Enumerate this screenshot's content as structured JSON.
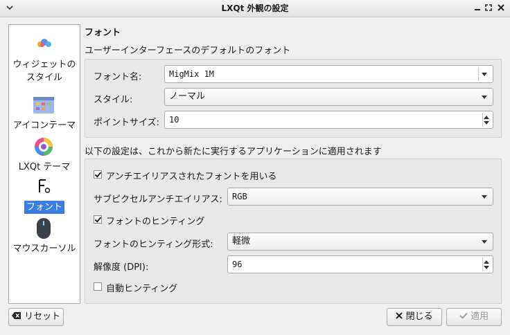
{
  "window": {
    "title": "LXQt 外観の設定"
  },
  "sidebar": {
    "items": [
      {
        "label_line1": "ウィジェットの",
        "label_line2": "スタイル",
        "icon": "widget-style-icon"
      },
      {
        "label": "アイコンテーマ",
        "icon": "icon-theme-icon"
      },
      {
        "label": "LXQt テーマ",
        "icon": "lxqt-theme-icon"
      },
      {
        "label": "フォント",
        "icon": "font-icon",
        "selected": true
      },
      {
        "label": "マウスカーソル",
        "icon": "mouse-cursor-icon"
      }
    ]
  },
  "main": {
    "heading": "フォント",
    "default_font_caption": "ユーザーインターフェースのデフォルトのフォント",
    "font_name_label": "フォント名:",
    "font_name_value": "MigMix 1M",
    "style_label": "スタイル:",
    "style_value": "ノーマル",
    "point_size_label": "ポイントサイズ:",
    "point_size_value": "10",
    "apply_caption": "以下の設定は、これから新たに実行するアプリケーションに適用されます",
    "antialias_label": "アンチエイリアスされたフォントを用いる",
    "antialias_checked": true,
    "subpixel_label": "サブピクセルアンチエイリアス:",
    "subpixel_value": "RGB",
    "hinting_label": "フォントのヒンティング",
    "hinting_checked": true,
    "hint_style_label": "フォントのヒンティング形式:",
    "hint_style_value": "軽微",
    "dpi_label": "解像度 (DPI):",
    "dpi_value": "96",
    "autohint_label": "自動ヒンティング",
    "autohint_checked": false
  },
  "buttons": {
    "reset": "リセット",
    "close": "閉じる",
    "apply": "適用"
  }
}
